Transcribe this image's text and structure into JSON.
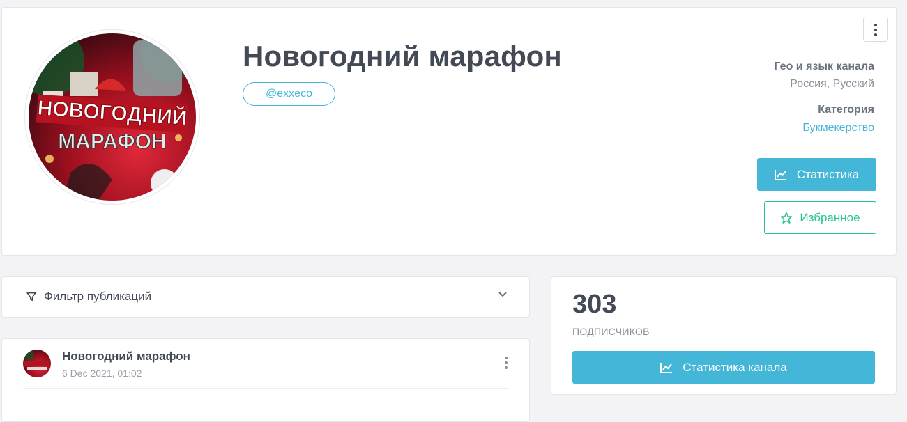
{
  "profile": {
    "title": "Новогодний марафон",
    "handle": "@exxeco",
    "avatar_text": {
      "line1": "НОВОГОДНИЙ",
      "line2": "МАРАФОН"
    },
    "geo_label": "Гео и язык канала",
    "geo_value": "Россия, Русский",
    "category_label": "Категория",
    "category_value": "Букмекерство",
    "stats_button": "Статистика",
    "favorite_button": "Избранное",
    "menu_icon": "kebab-vertical-icon"
  },
  "filter": {
    "label": "Фильтр публикаций",
    "icon": "filter-funnel-icon",
    "toggle_icon": "chevron-down-icon"
  },
  "post": {
    "author": "Новогодний марафон",
    "date": "6 Dec 2021, 01:02"
  },
  "stats": {
    "subscribers_count": "303",
    "subscribers_label": "ПОДПИСЧИКОВ",
    "channel_stats_button": "Статистика канала"
  },
  "colors": {
    "accent": "#44b6d8",
    "favorite": "#27c48a",
    "text_dark": "#434a56",
    "background": "#f3f3f6"
  }
}
